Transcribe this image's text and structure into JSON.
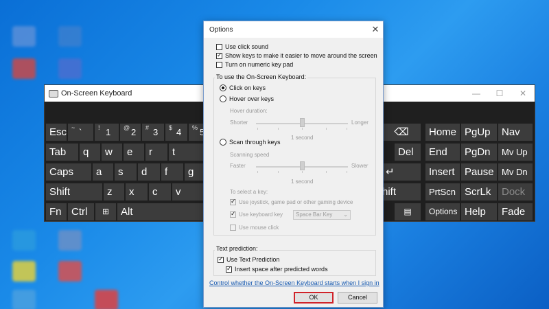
{
  "desktop": {
    "icon_colors": [
      "#5a8fd8",
      "#3a7fd0",
      "#c84a4a",
      "#4a6fd0",
      "#2a9adf",
      "#6a90c8",
      "#e0d040",
      "#d85050",
      "#4aa0e0",
      "#e04040"
    ]
  },
  "osk": {
    "title": "On-Screen Keyboard",
    "controls": {
      "minimize": "—",
      "maximize": "☐",
      "close": "✕"
    },
    "rows": [
      [
        "Esc",
        "~|`",
        "!|1",
        "@|2",
        "#|3",
        "$|4",
        "%|5",
        "⌫",
        "Home",
        "PgUp",
        "Nav"
      ],
      [
        "Tab",
        "q",
        "w",
        "e",
        "r",
        "t",
        "Del",
        "End",
        "PgDn",
        "Mv Up"
      ],
      [
        "Caps",
        "a",
        "s",
        "d",
        "f",
        "g",
        "↵",
        "Insert",
        "Pause",
        "Mv Dn"
      ],
      [
        "Shift",
        "z",
        "x",
        "c",
        "v",
        "hift",
        "PrtScn",
        "ScrLk",
        "Dock"
      ],
      [
        "Fn",
        "Ctrl",
        "⊞",
        "Alt",
        "▤",
        "Options",
        "Help",
        "Fade"
      ]
    ]
  },
  "dialog": {
    "title": "Options",
    "close_glyph": "✕",
    "checkboxes": [
      {
        "label": "Use click sound",
        "checked": false
      },
      {
        "label": "Show keys to make it easier to move around the screen",
        "checked": true
      },
      {
        "label": "Turn on numeric key pad",
        "checked": false
      }
    ],
    "use_group_label": "To use the On-Screen Keyboard:",
    "modes": {
      "click": "Click on keys",
      "hover": "Hover over keys",
      "scan": "Scan through keys"
    },
    "hover_duration": {
      "label": "Hover duration:",
      "left": "Shorter",
      "right": "Longer",
      "value": "1 second"
    },
    "scanning_speed": {
      "label": "Scanning speed",
      "left": "Faster",
      "right": "Slower",
      "value": "1 second"
    },
    "select_key": {
      "label": "To select a key:",
      "joystick": "Use joystick, game pad or other gaming device",
      "keyboard_key": "Use keyboard key",
      "keyboard_key_value": "Space Bar Key",
      "mouse_click": "Use mouse click"
    },
    "text_prediction": {
      "label": "Text prediction:",
      "use": "Use Text Prediction",
      "insert_space": "Insert space after predicted words"
    },
    "link": "Control whether the On-Screen Keyboard starts when I sign in",
    "ok": "OK",
    "cancel": "Cancel"
  }
}
